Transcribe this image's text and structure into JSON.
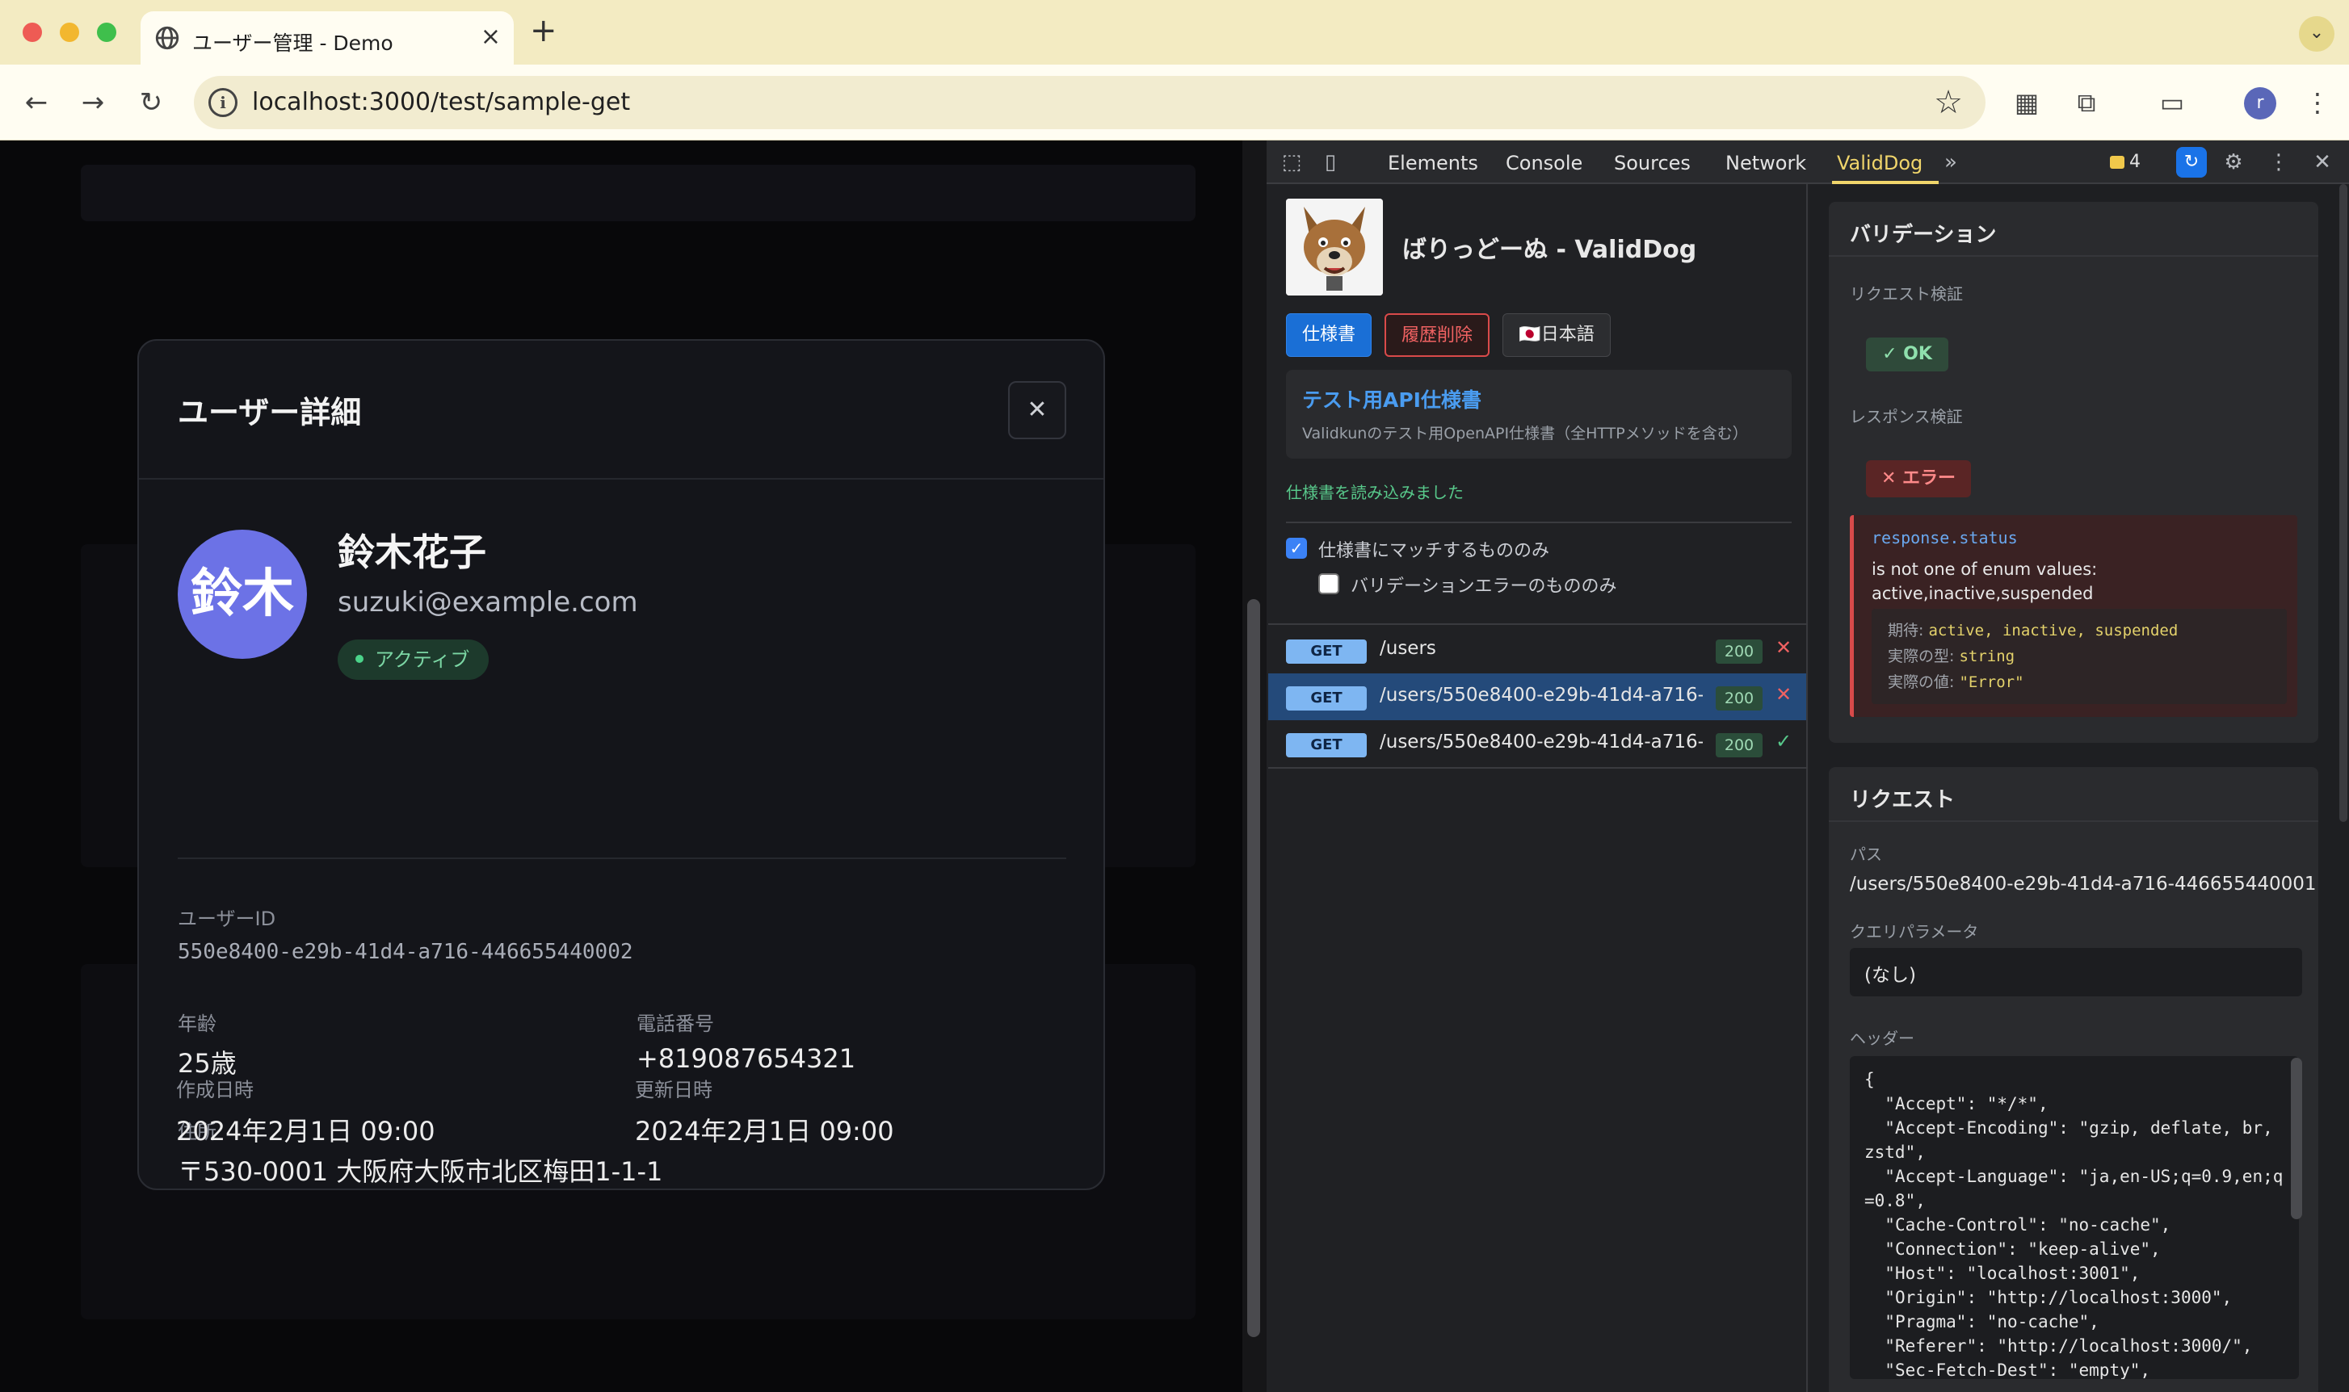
{
  "browser": {
    "tab_title": "ユーザー管理 - Demo",
    "new_tab": "+",
    "url": "localhost:3000/test/sample-get",
    "profile_initial": "r"
  },
  "modal": {
    "title": "ユーザー詳細",
    "avatar_text": "鈴木",
    "name": "鈴木花子",
    "email": "suzuki@example.com",
    "status": "アクティブ",
    "fields": {
      "user_id_label": "ユーザーID",
      "user_id": "550e8400-e29b-41d4-a716-446655440002",
      "age_label": "年齢",
      "age": "25歳",
      "phone_label": "電話番号",
      "phone": "+819087654321",
      "address_label": "住所",
      "address": "〒530-0001 大阪府大阪市北区梅田1-1-1",
      "created_label": "作成日時",
      "created": "2024年2月1日 09:00",
      "updated_label": "更新日時",
      "updated": "2024年2月1日 09:00"
    }
  },
  "devtools": {
    "tabs": [
      "Elements",
      "Console",
      "Sources",
      "Network",
      "ValidDog"
    ],
    "active_tab": "ValidDog",
    "issues_count": "4"
  },
  "validdog": {
    "title": "ばりっどーぬ - ValidDog",
    "buttons": {
      "spec": "仕様書",
      "clear": "履歴削除",
      "lang": "🇯🇵日本語"
    },
    "spec_card": {
      "title": "テスト用API仕様書",
      "desc": "Validkunのテスト用OpenAPI仕様書（全HTTPメソッドを含む）"
    },
    "spec_loaded": "仕様書を読み込みました",
    "filters": {
      "match_only": "仕様書にマッチするもののみ",
      "error_only": "バリデーションエラーのもののみ"
    },
    "requests": [
      {
        "method": "GET",
        "path": "/users",
        "status": "200",
        "result": "✕"
      },
      {
        "method": "GET",
        "path": "/users/550e8400-e29b-41d4-a716-...",
        "status": "200",
        "result": "✕"
      },
      {
        "method": "GET",
        "path": "/users/550e8400-e29b-41d4-a716-...",
        "status": "200",
        "result": "✓"
      }
    ],
    "validation": {
      "title": "バリデーション",
      "request_label": "リクエスト検証",
      "request_result": "✓ OK",
      "response_label": "レスポンス検証",
      "response_result": "✕ エラー",
      "error_field": "response.status",
      "error_message": "is not one of enum values: active,inactive,suspended",
      "expected_label": "期待:",
      "expected_value": "active, inactive, suspended",
      "actual_type_label": "実際の型:",
      "actual_type_value": "string",
      "actual_value_label": "実際の値:",
      "actual_value_value": "\"Error\""
    },
    "request_panel": {
      "title": "リクエスト",
      "path_label": "パス",
      "path": "/users/550e8400-e29b-41d4-a716-446655440001",
      "query_label": "クエリパラメータ",
      "query": "(なし)",
      "headers_label": "ヘッダー",
      "headers": "{\n  \"Accept\": \"*/*\",\n  \"Accept-Encoding\": \"gzip, deflate, br, zstd\",\n  \"Accept-Language\": \"ja,en-US;q=0.9,en;q=0.8\",\n  \"Cache-Control\": \"no-cache\",\n  \"Connection\": \"keep-alive\",\n  \"Host\": \"localhost:3001\",\n  \"Origin\": \"http://localhost:3000\",\n  \"Pragma\": \"no-cache\",\n  \"Referer\": \"http://localhost:3000/\",\n  \"Sec-Fetch-Dest\": \"empty\","
    }
  }
}
